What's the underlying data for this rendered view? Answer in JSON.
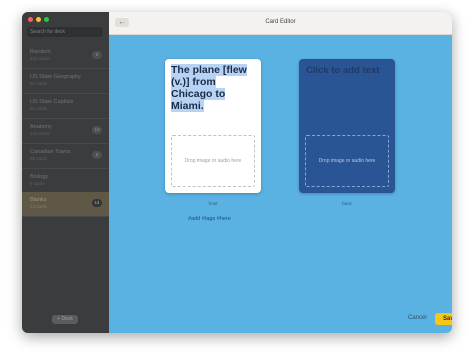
{
  "window": {
    "title": "Card Editor",
    "back_icon": "arrow-left-icon"
  },
  "traffic_lights": {
    "close_color": "#ff5f57",
    "minimize_color": "#febc2e",
    "zoom_color": "#28c840"
  },
  "sidebar": {
    "search_placeholder": "Search for deck",
    "items": [
      {
        "name": "Random",
        "count": "633 cards",
        "badge": "9"
      },
      {
        "name": "US State Geography",
        "count": "50 cards",
        "badge": ""
      },
      {
        "name": "US State Capitals",
        "count": "50 cards",
        "badge": ""
      },
      {
        "name": "Anatomy",
        "count": "123 cards",
        "badge": "10"
      },
      {
        "name": "Canadian Towns",
        "count": "55 cards",
        "badge": "6"
      },
      {
        "name": "Biology",
        "count": "9 cards",
        "badge": ""
      },
      {
        "name": "Blanks",
        "count": "14 cards",
        "badge": "14",
        "selected": true
      }
    ],
    "add_deck_label": "+ Deck"
  },
  "editor": {
    "front": {
      "text": "The plane [flew (v.)] from Chicago to Miami.",
      "dropzone_label": "Drop image or audio here",
      "label": "front"
    },
    "back": {
      "placeholder": "Click to add text",
      "dropzone_label": "Drop image or audio here",
      "label": "back"
    },
    "tags": "#add #tags #here"
  },
  "footer": {
    "cancel_label": "Cancel",
    "save_label": "Save"
  },
  "colors": {
    "background": "#5ab2e3",
    "sidebar": "#3a3c3e",
    "back_card": "#2a5594",
    "save_button": "#f6c61a",
    "selected_deck": "#5f5847"
  }
}
